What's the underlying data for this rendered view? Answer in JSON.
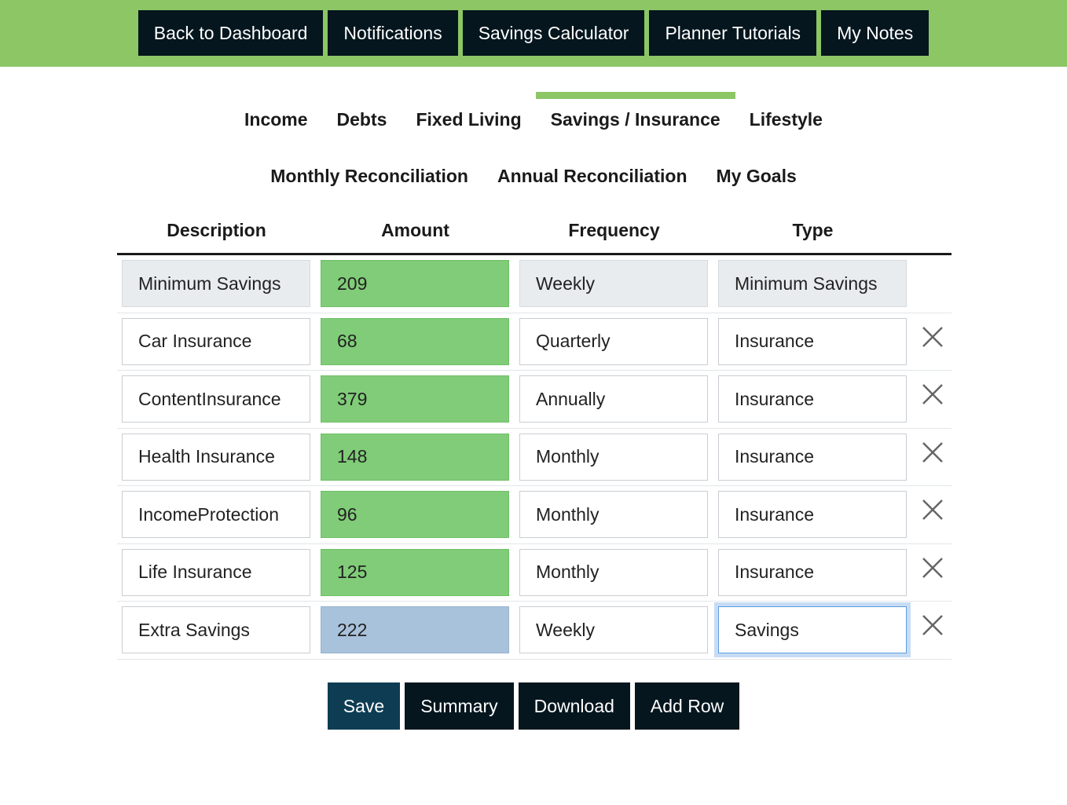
{
  "nav": {
    "buttons": [
      "Back to Dashboard",
      "Notifications",
      "Savings Calculator",
      "Planner Tutorials",
      "My Notes"
    ]
  },
  "tabs": {
    "row1": [
      "Income",
      "Debts",
      "Fixed Living",
      "Savings / Insurance",
      "Lifestyle"
    ],
    "row2": [
      "Monthly Reconciliation",
      "Annual Reconciliation",
      "My Goals"
    ],
    "active": "Savings / Insurance"
  },
  "table": {
    "headers": [
      "Description",
      "Amount",
      "Frequency",
      "Type"
    ],
    "rows": [
      {
        "description": "Minimum Savings",
        "amount": "209",
        "frequency": "Weekly",
        "type": "Minimum Savings"
      },
      {
        "description": "Car Insurance",
        "amount": "68",
        "frequency": "Quarterly",
        "type": "Insurance"
      },
      {
        "description": "ContentInsurance",
        "amount": "379",
        "frequency": "Annually",
        "type": "Insurance"
      },
      {
        "description": "Health Insurance",
        "amount": "148",
        "frequency": "Monthly",
        "type": "Insurance"
      },
      {
        "description": "IncomeProtection",
        "amount": "96",
        "frequency": "Monthly",
        "type": "Insurance"
      },
      {
        "description": "Life Insurance",
        "amount": "125",
        "frequency": "Monthly",
        "type": "Insurance"
      },
      {
        "description": "Extra Savings",
        "amount": "222",
        "frequency": "Weekly",
        "type": "Savings"
      }
    ]
  },
  "actions": {
    "save": "Save",
    "summary": "Summary",
    "download": "Download",
    "add_row": "Add Row"
  },
  "colors": {
    "accent_green": "#8cc665",
    "dark_button": "#05161e",
    "amount_fill": "#80cc78"
  }
}
